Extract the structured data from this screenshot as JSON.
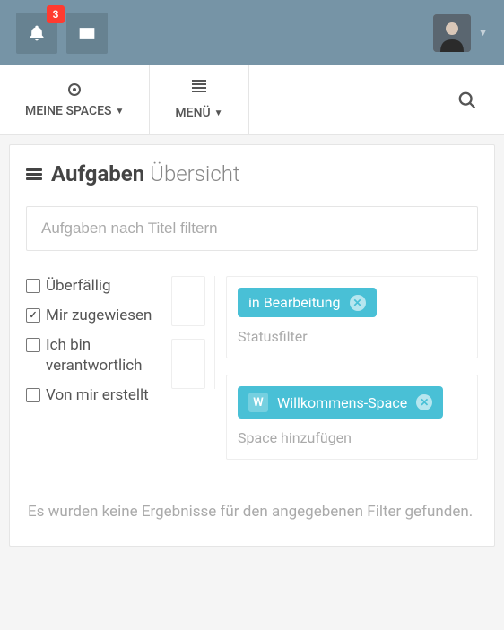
{
  "topbar": {
    "notification_count": "3"
  },
  "nav": {
    "my_spaces": "MEINE SPACES",
    "menu": "MENÜ"
  },
  "page": {
    "title_bold": "Aufgaben",
    "title_thin": "Übersicht",
    "filter_placeholder": "Aufgaben nach Titel filtern"
  },
  "checks": {
    "overdue": "Überfällig",
    "assigned": "Mir zugewiesen",
    "responsible": "Ich bin verantwortlich",
    "created": "Von mir erstellt"
  },
  "status_group": {
    "tag": "in Bearbeitung",
    "add_placeholder": "Statusfilter"
  },
  "space_group": {
    "tag_letter": "W",
    "tag": "Willkommens-Space",
    "add_placeholder": "Space hinzufügen"
  },
  "empty": "Es wurden keine Ergebnisse für den angegebenen Filter gefunden."
}
